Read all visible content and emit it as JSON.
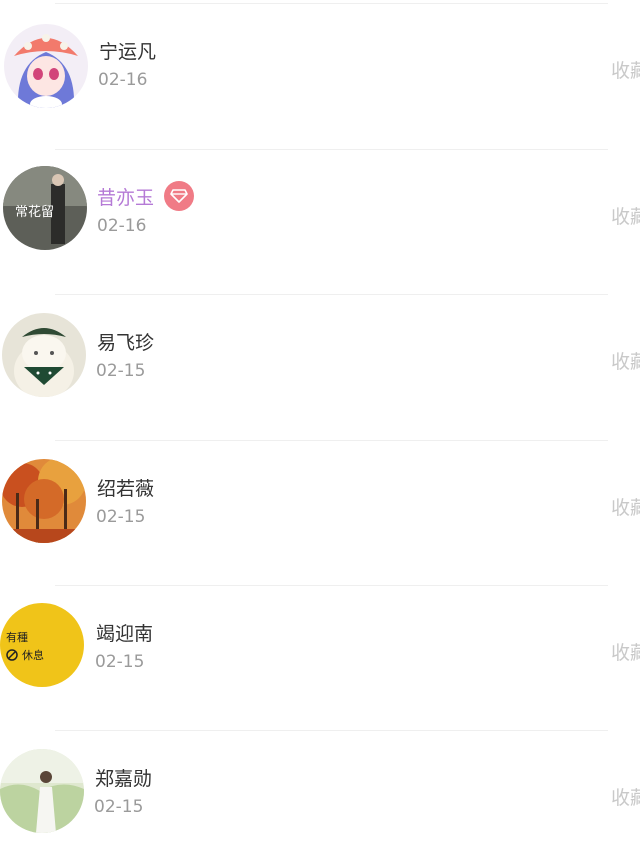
{
  "items": [
    {
      "name": "宁运凡",
      "date": "02-16",
      "action": "收藏",
      "vip": false,
      "avatar_icon": "anime-girl-avatar-icon"
    },
    {
      "name": "昔亦玉",
      "date": "02-16",
      "action": "收藏",
      "vip": true,
      "badge_icon": "diamond-icon",
      "avatar_icon": "photo-avatar-icon",
      "avatar_text": "常花留"
    },
    {
      "name": "易飞珍",
      "date": "02-15",
      "action": "收藏",
      "vip": false,
      "avatar_icon": "cat-avatar-icon"
    },
    {
      "name": "绍若薇",
      "date": "02-15",
      "action": "收藏",
      "vip": false,
      "avatar_icon": "autumn-forest-avatar-icon"
    },
    {
      "name": "竭迎南",
      "date": "02-15",
      "action": "收藏",
      "vip": false,
      "avatar_icon": "yellow-text-avatar-icon",
      "avatar_text_1": "有種",
      "avatar_text_2": "休息"
    },
    {
      "name": "郑嘉勋",
      "date": "02-15",
      "action": "收藏",
      "vip": false,
      "avatar_icon": "girl-in-field-avatar-icon"
    }
  ],
  "colors": {
    "vip_name": "#b57ad6",
    "vip_badge": "#f07b86",
    "date": "#9a9a9a",
    "action": "#c9c9c9"
  }
}
